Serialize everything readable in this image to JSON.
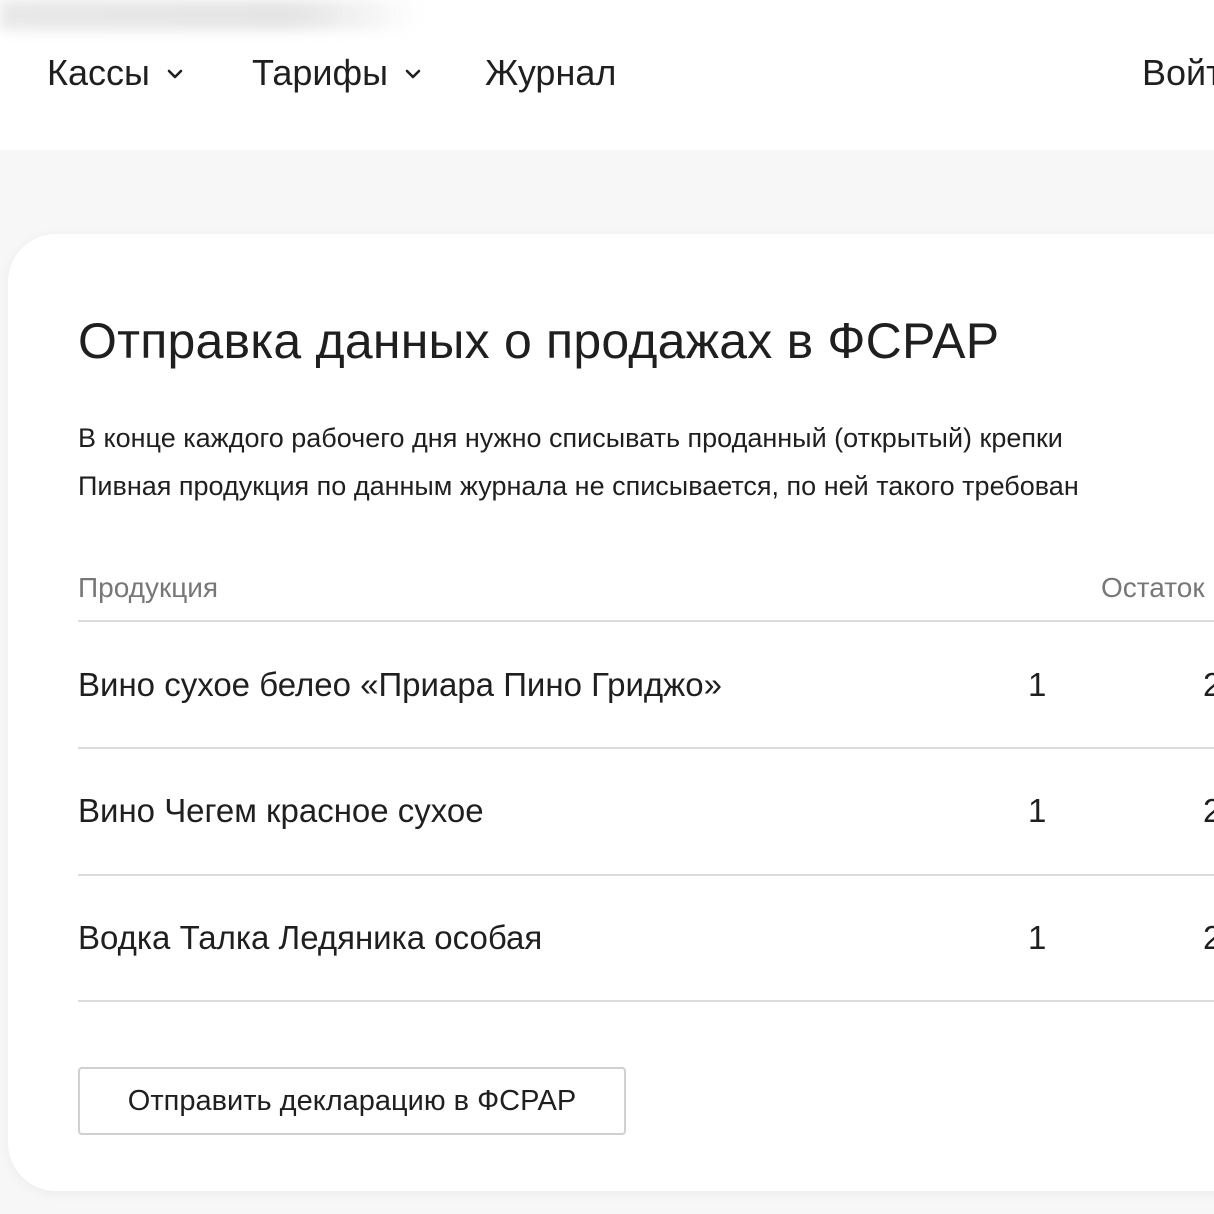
{
  "nav": {
    "items": [
      {
        "label": "Кассы",
        "has_dropdown": true
      },
      {
        "label": "Тарифы",
        "has_dropdown": true
      },
      {
        "label": "Журнал",
        "has_dropdown": false
      }
    ],
    "login_label": "Войт"
  },
  "card": {
    "title": "Отправка данных о продажах в ФСРАР",
    "description": [
      "В конце каждого рабочего дня нужно списывать проданный (открытый) крепки",
      "Пивная продукция по данным журнала не списывается, по ней такого требован"
    ],
    "table": {
      "headers": {
        "product": "Продукция",
        "remainder": "Остаток"
      },
      "rows": [
        {
          "name": "Вино сухое белео «Приара Пино Гриджо»",
          "qty": "1",
          "remainder": "2"
        },
        {
          "name": "Вино Чегем красное сухое",
          "qty": "1",
          "remainder": "2"
        },
        {
          "name": "Водка Талка Ледяника особая",
          "qty": "1",
          "remainder": "2"
        }
      ]
    },
    "submit_label": "Отправить декларацию в ФСРАР"
  },
  "icons": {
    "dropdown": "chevron-down-icon"
  },
  "colors": {
    "text": "#1f1f1f",
    "muted": "#777777",
    "divider": "#dcdcdc",
    "page_bg": "#f7f7f7",
    "card_bg": "#ffffff"
  }
}
